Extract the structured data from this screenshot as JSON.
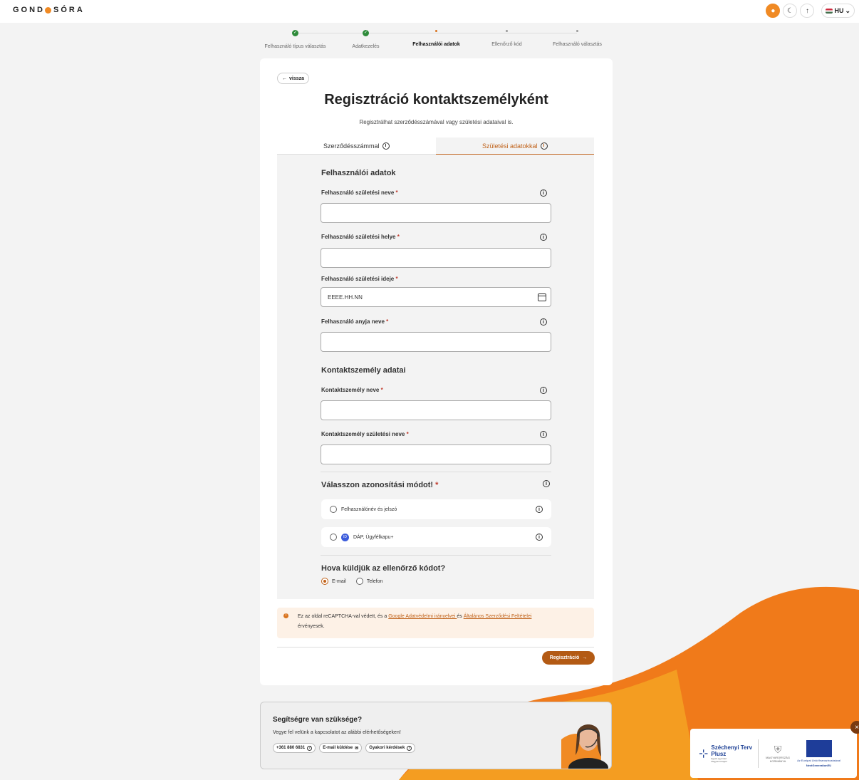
{
  "brand": {
    "logo_left": "GOND",
    "logo_right": "SÓRA"
  },
  "top": {
    "lang": "HU"
  },
  "steps": [
    {
      "label": "Felhasználó típus választás",
      "state": "done"
    },
    {
      "label": "Adatkezelés",
      "state": "done"
    },
    {
      "label": "Felhasználói adatok",
      "state": "current"
    },
    {
      "label": "Ellenőrző kód",
      "state": "todo"
    },
    {
      "label": "Felhasználó választás",
      "state": "todo"
    }
  ],
  "card": {
    "back": "vissza",
    "title": "Regisztráció kontaktszemélyként",
    "subtitle": "Regisztrálhat szerződésszámával vagy születési adataival is.",
    "tab_contract": "Szerződésszámmal",
    "tab_birth": "Születési adatokkal"
  },
  "form": {
    "section_user": "Felhasználói adatok",
    "birth_name": "Felhasználó születési neve",
    "birth_place": "Felhasználó születési helye",
    "birth_date": "Felhasználó születési ideje",
    "birth_date_placeholder": "EEEE.HH.NN",
    "mother_name": "Felhasználó anyja neve",
    "section_contact": "Kontaktszemély adatai",
    "contact_name": "Kontaktszemély neve",
    "contact_birth_name": "Kontaktszemély születési neve",
    "auth_title": "Válasszon azonosítási módot!",
    "auth_option_1": "Felhasználónév és jelszó",
    "auth_option_2": "DÁP, Ügyfélkapu+",
    "send_title": "Hova küldjük az ellenőrző kódot?",
    "send_email": "E-mail",
    "send_phone": "Telefon",
    "required_mark": "*"
  },
  "notice": {
    "text_1": "Ez az oldal reCAPTCHA-val védett, és a ",
    "link_1": "Google Adatvédelmi irányelvei ",
    "text_2": "és ",
    "link_2": "Általános Szerződési Feltételei",
    "text_3": "érvényesek."
  },
  "register_button": "Regisztráció",
  "help": {
    "title": "Segítségre van szüksége?",
    "text": "Vegye fel velünk a kapcsolatot az alábbi elérhetőségeken!",
    "phone": "+361 880 6831",
    "email": "E-mail küldése",
    "faq": "Gyakori kérdések"
  },
  "footer": {
    "sz_title": "Széchenyi Terv",
    "sz_plus": "Plusz",
    "sz_sub": "Együtt egymáért Magyarországért",
    "hu_gov": "MAGYARORSZÁG KORMÁNYA",
    "eu_text": "Az Európai Unió finanszírozásával",
    "eu_ng": "NextGenerationEU"
  },
  "colors": {
    "accent": "#d9731e",
    "button": "#b35a14",
    "success": "#2e8b3a"
  }
}
